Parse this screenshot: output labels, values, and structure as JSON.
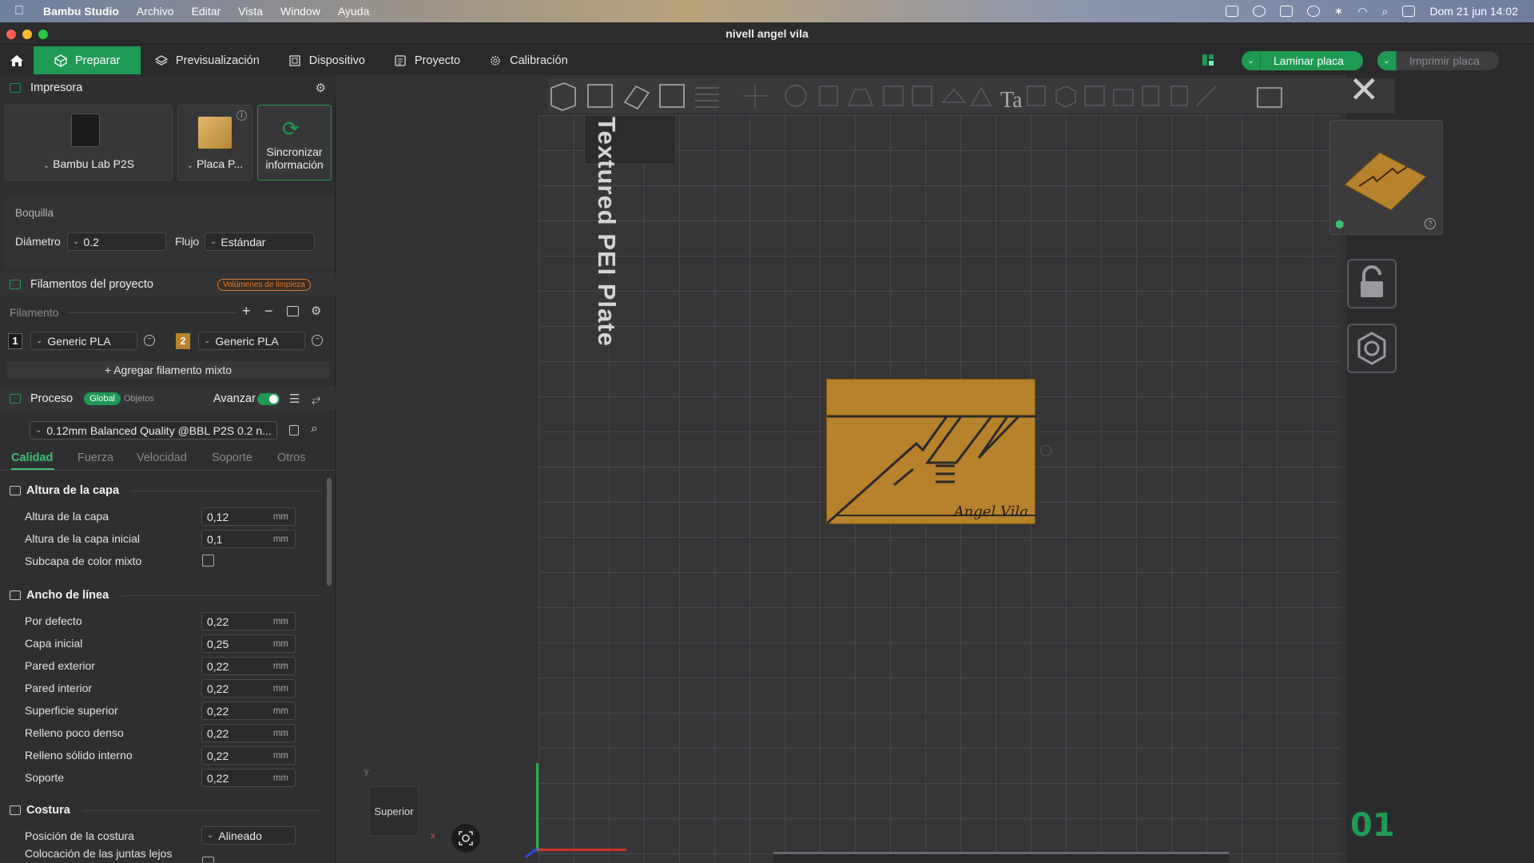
{
  "menubar": {
    "app": "Bambu Studio",
    "items": [
      "Archivo",
      "Editar",
      "Vista",
      "Window",
      "Ayuda"
    ],
    "clock": "Dom 21 jun 14:02"
  },
  "window": {
    "title": "nivell angel vila"
  },
  "toolbar": {
    "tabs": [
      "Preparar",
      "Previsualización",
      "Dispositivo",
      "Proyecto",
      "Calibración"
    ],
    "slice": "Laminar placa",
    "print": "Imprimir placa"
  },
  "printer": {
    "title": "Impresora",
    "printer_name": "Bambu Lab P2S",
    "plate_name": "Placa P...",
    "sync_line1": "Sincronizar",
    "sync_line2": "información",
    "nozzle_title": "Boquilla",
    "diameter_label": "Diámetro",
    "diameter_value": "0.2",
    "flow_label": "Flujo",
    "flow_value": "Estándar"
  },
  "filaments": {
    "title": "Filamentos del proyecto",
    "badge": "Volúmenes de limpieza",
    "subhead": "Filamento",
    "items": [
      {
        "index": "1",
        "name": "Generic PLA",
        "color": "#1a1a1a"
      },
      {
        "index": "2",
        "name": "Generic PLA",
        "color": "#b7822c"
      }
    ],
    "add_mixed": "Agregar filamento mixto"
  },
  "process": {
    "title": "Proceso",
    "global": "Global",
    "objects": "Objetos",
    "advanced": "Avanzar",
    "preset": "0.12mm Balanced Quality @BBL P2S 0.2 n...",
    "tabs": [
      "Calidad",
      "Fuerza",
      "Velocidad",
      "Soporte",
      "Otros"
    ]
  },
  "groups": {
    "layer_height": {
      "title": "Altura de la capa",
      "rows": [
        {
          "label": "Altura de la capa",
          "value": "0,12",
          "unit": "mm"
        },
        {
          "label": "Altura de la capa inicial",
          "value": "0,1",
          "unit": "mm"
        }
      ],
      "mixed_label": "Subcapa de color mixto"
    },
    "line_width": {
      "title": "Ancho de línea",
      "rows": [
        {
          "label": "Por defecto",
          "value": "0,22",
          "unit": "mm"
        },
        {
          "label": "Capa inicial",
          "value": "0,25",
          "unit": "mm"
        },
        {
          "label": "Pared exterior",
          "value": "0,22",
          "unit": "mm"
        },
        {
          "label": "Pared interior",
          "value": "0,22",
          "unit": "mm"
        },
        {
          "label": "Superficie superior",
          "value": "0,22",
          "unit": "mm"
        },
        {
          "label": "Relleno poco denso",
          "value": "0,22",
          "unit": "mm"
        },
        {
          "label": "Relleno sólido interno",
          "value": "0,22",
          "unit": "mm"
        },
        {
          "label": "Soporte",
          "value": "0,22",
          "unit": "mm"
        }
      ]
    },
    "seam": {
      "title": "Costura",
      "position_label": "Posición de la costura",
      "position_value": "Alineado",
      "placement_label": "Colocación de las juntas lejos"
    }
  },
  "viewport": {
    "plate_label": "Textured PEI Plate",
    "view_label": "Superior",
    "plate_number": "01",
    "model_signature": "Angel Vila",
    "axis_x": "x",
    "axis_y": "y"
  },
  "colors": {
    "accent": "#1f9a53",
    "model": "#b7822c"
  }
}
